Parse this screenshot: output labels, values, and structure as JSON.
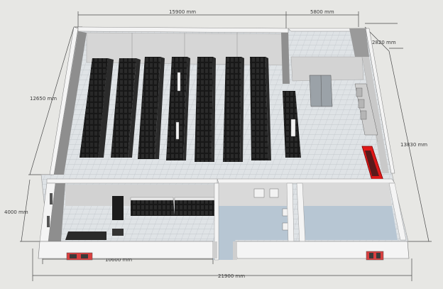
{
  "dimensions": {
    "top_left": "15900 mm",
    "top_right": "5800 mm",
    "corner_right": "2820 mm",
    "left_side": "12650 mm",
    "right_side": "13830 mm",
    "left_lower": "4000 mm",
    "bottom_inner": "10600 mm",
    "bottom_total": "21900 mm"
  },
  "colors": {
    "background": "#e7e7e4",
    "wall": "#f4f4f4",
    "wall_inner": "#d2d2d2",
    "floor_tile": "#dfe3e6",
    "rack": "#171717",
    "blue_floor": "#b7c6d3",
    "fire_cabinet": "#e01818",
    "dimension_line": "#4a4a4a"
  },
  "icons": [
    "rack-icon",
    "door-icon",
    "fire-extinguisher-cabinet-icon",
    "air-conditioner-icon",
    "wash-basin-icon"
  ]
}
